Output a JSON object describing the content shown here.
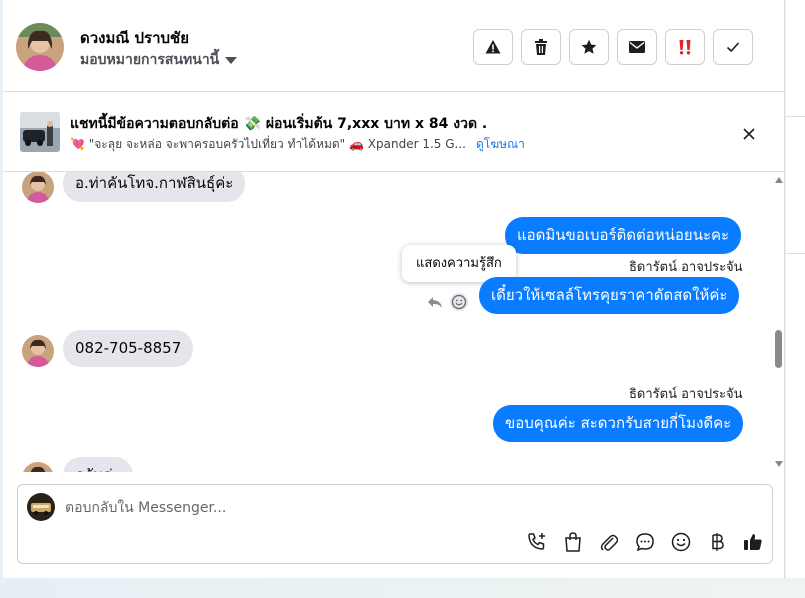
{
  "header": {
    "contact_name": "ดวงมณี ปราบชัย",
    "assign_label": "มอบหมายการสนทนานี้",
    "actions": [
      {
        "name": "report-icon",
        "label": "!"
      },
      {
        "name": "trash-icon",
        "label": ""
      },
      {
        "name": "star-icon",
        "label": "★"
      },
      {
        "name": "envelope-icon",
        "label": ""
      },
      {
        "name": "double-exclamation-icon",
        "label": "‼"
      },
      {
        "name": "check-icon",
        "label": "✓"
      }
    ]
  },
  "ad": {
    "title": "แชทนี้มีข้อความตอบกลับต่อ 💸 ผ่อนเริ่มต้น 7,xxx บาท x 84 งวด .",
    "subtitle": "💘 \"จะลุย จะหล่อ จะพาครอบครัวไปเที่ยว ทำได้หมด\" 🚗 Xpander 1.5 G...",
    "link": "ดูโฆษณา"
  },
  "messages": {
    "m1": "อ.ท่าคันโทจ.กาฬสินธุ์ค่ะ",
    "m2": "แอดมินขอเบอร์ติดต่อหน่อยนะคะ",
    "sender1": "ธิดารัตน์ อาจประจัน",
    "m3": "เดี๋ยวให้เซลล์โทรคุยราคาดัดสดให้ค่ะ",
    "tooltip": "แสดงความรู้สึก",
    "m4": "082-705-8857",
    "sender2": "ธิดารัตน์ อาจประจัน",
    "m5": "ขอบคุณค่ะ สะดวกรับสายกี่โมงดีคะ",
    "m6": "ครับค่ะ"
  },
  "composer": {
    "placeholder": "ตอบกลับใน Messenger..."
  },
  "colors": {
    "outgoing_bubble": "#0a7cff",
    "incoming_bubble": "#e4e6eb",
    "link": "#1877f2"
  }
}
